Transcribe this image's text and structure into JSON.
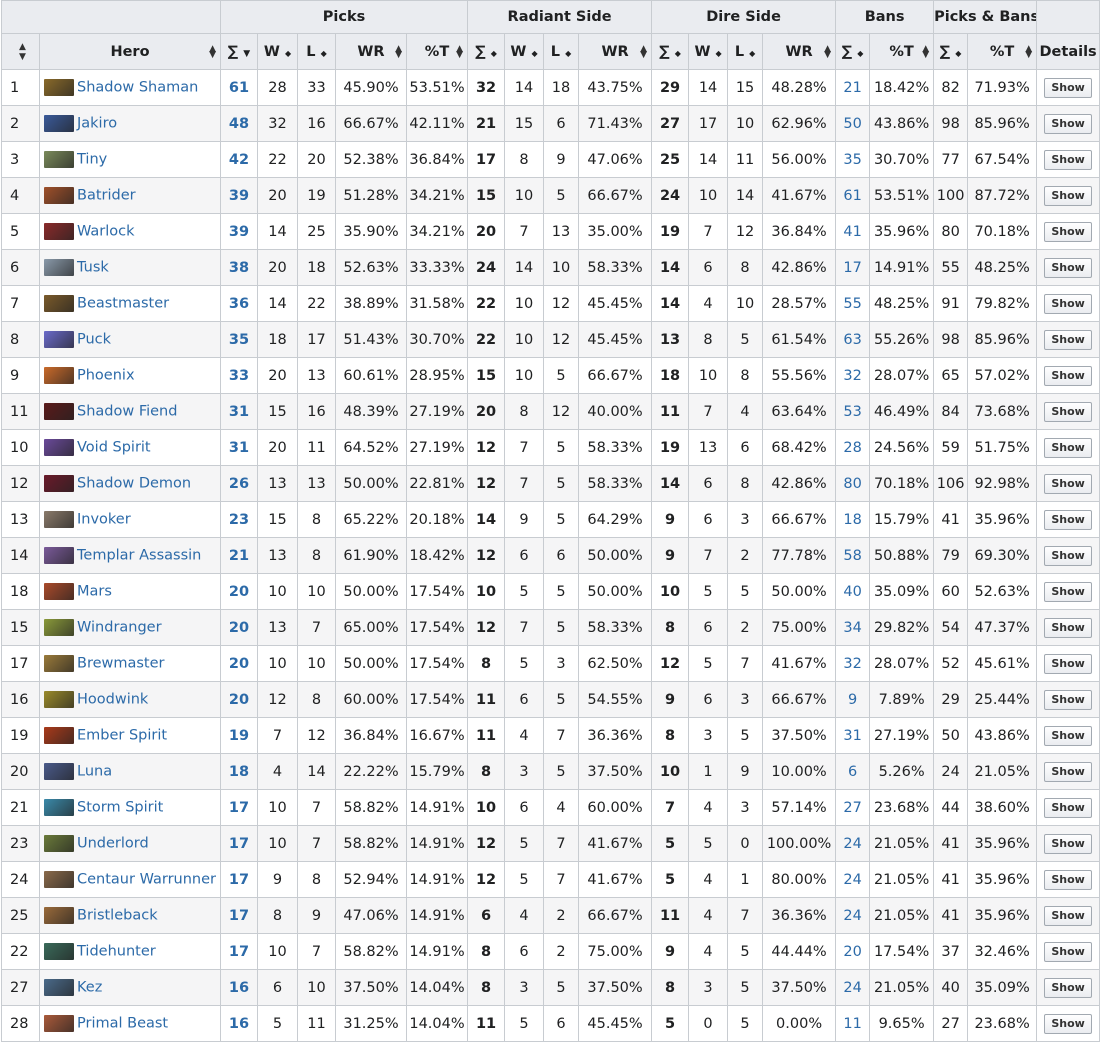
{
  "groups": [
    "Picks",
    "Radiant Side",
    "Dire Side",
    "Bans",
    "Picks & Bans"
  ],
  "columns": [
    "Hero",
    "∑",
    "W",
    "L",
    "WR",
    "%T",
    "∑",
    "W",
    "L",
    "WR",
    "∑",
    "W",
    "L",
    "WR",
    "∑",
    "%T",
    "∑",
    "%T",
    "Details"
  ],
  "button_label": "Show",
  "rows": [
    {
      "rank": "1",
      "hero": "Shadow Shaman",
      "ic": "#8a6a2a",
      "pt": "61",
      "pw": "28",
      "pl": "33",
      "pwr": "45.90%",
      "ppt": "53.51%",
      "rt": "32",
      "rw": "14",
      "rl": "18",
      "rwr": "43.75%",
      "dt": "29",
      "dw": "14",
      "dl": "15",
      "dwr": "48.28%",
      "bt": "21",
      "bpt": "18.42%",
      "pbt": "82",
      "pbpt": "71.93%"
    },
    {
      "rank": "2",
      "hero": "Jakiro",
      "ic": "#3a5a9a",
      "pt": "48",
      "pw": "32",
      "pl": "16",
      "pwr": "66.67%",
      "ppt": "42.11%",
      "rt": "21",
      "rw": "15",
      "rl": "6",
      "rwr": "71.43%",
      "dt": "27",
      "dw": "17",
      "dl": "10",
      "dwr": "62.96%",
      "bt": "50",
      "bpt": "43.86%",
      "pbt": "98",
      "pbpt": "85.96%"
    },
    {
      "rank": "3",
      "hero": "Tiny",
      "ic": "#7a8a5a",
      "pt": "42",
      "pw": "22",
      "pl": "20",
      "pwr": "52.38%",
      "ppt": "36.84%",
      "rt": "17",
      "rw": "8",
      "rl": "9",
      "rwr": "47.06%",
      "dt": "25",
      "dw": "14",
      "dl": "11",
      "dwr": "56.00%",
      "bt": "35",
      "bpt": "30.70%",
      "pbt": "77",
      "pbpt": "67.54%"
    },
    {
      "rank": "4",
      "hero": "Batrider",
      "ic": "#a0502a",
      "pt": "39",
      "pw": "20",
      "pl": "19",
      "pwr": "51.28%",
      "ppt": "34.21%",
      "rt": "15",
      "rw": "10",
      "rl": "5",
      "rwr": "66.67%",
      "dt": "24",
      "dw": "10",
      "dl": "14",
      "dwr": "41.67%",
      "bt": "61",
      "bpt": "53.51%",
      "pbt": "100",
      "pbpt": "87.72%"
    },
    {
      "rank": "5",
      "hero": "Warlock",
      "ic": "#8a2a2a",
      "pt": "39",
      "pw": "14",
      "pl": "25",
      "pwr": "35.90%",
      "ppt": "34.21%",
      "rt": "20",
      "rw": "7",
      "rl": "13",
      "rwr": "35.00%",
      "dt": "19",
      "dw": "7",
      "dl": "12",
      "dwr": "36.84%",
      "bt": "41",
      "bpt": "35.96%",
      "pbt": "80",
      "pbpt": "70.18%"
    },
    {
      "rank": "6",
      "hero": "Tusk",
      "ic": "#8a9aaa",
      "pt": "38",
      "pw": "20",
      "pl": "18",
      "pwr": "52.63%",
      "ppt": "33.33%",
      "rt": "24",
      "rw": "14",
      "rl": "10",
      "rwr": "58.33%",
      "dt": "14",
      "dw": "6",
      "dl": "8",
      "dwr": "42.86%",
      "bt": "17",
      "bpt": "14.91%",
      "pbt": "55",
      "pbpt": "48.25%"
    },
    {
      "rank": "7",
      "hero": "Beastmaster",
      "ic": "#7a5a2a",
      "pt": "36",
      "pw": "14",
      "pl": "22",
      "pwr": "38.89%",
      "ppt": "31.58%",
      "rt": "22",
      "rw": "10",
      "rl": "12",
      "rwr": "45.45%",
      "dt": "14",
      "dw": "4",
      "dl": "10",
      "dwr": "28.57%",
      "bt": "55",
      "bpt": "48.25%",
      "pbt": "91",
      "pbpt": "79.82%"
    },
    {
      "rank": "8",
      "hero": "Puck",
      "ic": "#6a6aca",
      "pt": "35",
      "pw": "18",
      "pl": "17",
      "pwr": "51.43%",
      "ppt": "30.70%",
      "rt": "22",
      "rw": "10",
      "rl": "12",
      "rwr": "45.45%",
      "dt": "13",
      "dw": "8",
      "dl": "5",
      "dwr": "61.54%",
      "bt": "63",
      "bpt": "55.26%",
      "pbt": "98",
      "pbpt": "85.96%"
    },
    {
      "rank": "9",
      "hero": "Phoenix",
      "ic": "#ca6a2a",
      "pt": "33",
      "pw": "20",
      "pl": "13",
      "pwr": "60.61%",
      "ppt": "28.95%",
      "rt": "15",
      "rw": "10",
      "rl": "5",
      "rwr": "66.67%",
      "dt": "18",
      "dw": "10",
      "dl": "8",
      "dwr": "55.56%",
      "bt": "32",
      "bpt": "28.07%",
      "pbt": "65",
      "pbpt": "57.02%"
    },
    {
      "rank": "11",
      "hero": "Shadow Fiend",
      "ic": "#5a1a1a",
      "pt": "31",
      "pw": "15",
      "pl": "16",
      "pwr": "48.39%",
      "ppt": "27.19%",
      "rt": "20",
      "rw": "8",
      "rl": "12",
      "rwr": "40.00%",
      "dt": "11",
      "dw": "7",
      "dl": "4",
      "dwr": "63.64%",
      "bt": "53",
      "bpt": "46.49%",
      "pbt": "84",
      "pbpt": "73.68%"
    },
    {
      "rank": "10",
      "hero": "Void Spirit",
      "ic": "#6a4a9a",
      "pt": "31",
      "pw": "20",
      "pl": "11",
      "pwr": "64.52%",
      "ppt": "27.19%",
      "rt": "12",
      "rw": "7",
      "rl": "5",
      "rwr": "58.33%",
      "dt": "19",
      "dw": "13",
      "dl": "6",
      "dwr": "68.42%",
      "bt": "28",
      "bpt": "24.56%",
      "pbt": "59",
      "pbpt": "51.75%"
    },
    {
      "rank": "12",
      "hero": "Shadow Demon",
      "ic": "#6a1a2a",
      "pt": "26",
      "pw": "13",
      "pl": "13",
      "pwr": "50.00%",
      "ppt": "22.81%",
      "rt": "12",
      "rw": "7",
      "rl": "5",
      "rwr": "58.33%",
      "dt": "14",
      "dw": "6",
      "dl": "8",
      "dwr": "42.86%",
      "bt": "80",
      "bpt": "70.18%",
      "pbt": "106",
      "pbpt": "92.98%"
    },
    {
      "rank": "13",
      "hero": "Invoker",
      "ic": "#8a7a6a",
      "pt": "23",
      "pw": "15",
      "pl": "8",
      "pwr": "65.22%",
      "ppt": "20.18%",
      "rt": "14",
      "rw": "9",
      "rl": "5",
      "rwr": "64.29%",
      "dt": "9",
      "dw": "6",
      "dl": "3",
      "dwr": "66.67%",
      "bt": "18",
      "bpt": "15.79%",
      "pbt": "41",
      "pbpt": "35.96%"
    },
    {
      "rank": "14",
      "hero": "Templar Assassin",
      "ic": "#7a5a9a",
      "pt": "21",
      "pw": "13",
      "pl": "8",
      "pwr": "61.90%",
      "ppt": "18.42%",
      "rt": "12",
      "rw": "6",
      "rl": "6",
      "rwr": "50.00%",
      "dt": "9",
      "dw": "7",
      "dl": "2",
      "dwr": "77.78%",
      "bt": "58",
      "bpt": "50.88%",
      "pbt": "79",
      "pbpt": "69.30%"
    },
    {
      "rank": "18",
      "hero": "Mars",
      "ic": "#aa4a2a",
      "pt": "20",
      "pw": "10",
      "pl": "10",
      "pwr": "50.00%",
      "ppt": "17.54%",
      "rt": "10",
      "rw": "5",
      "rl": "5",
      "rwr": "50.00%",
      "dt": "10",
      "dw": "5",
      "dl": "5",
      "dwr": "50.00%",
      "bt": "40",
      "bpt": "35.09%",
      "pbt": "60",
      "pbpt": "52.63%"
    },
    {
      "rank": "15",
      "hero": "Windranger",
      "ic": "#8a9a3a",
      "pt": "20",
      "pw": "13",
      "pl": "7",
      "pwr": "65.00%",
      "ppt": "17.54%",
      "rt": "12",
      "rw": "7",
      "rl": "5",
      "rwr": "58.33%",
      "dt": "8",
      "dw": "6",
      "dl": "2",
      "dwr": "75.00%",
      "bt": "34",
      "bpt": "29.82%",
      "pbt": "54",
      "pbpt": "47.37%"
    },
    {
      "rank": "17",
      "hero": "Brewmaster",
      "ic": "#9a7a3a",
      "pt": "20",
      "pw": "10",
      "pl": "10",
      "pwr": "50.00%",
      "ppt": "17.54%",
      "rt": "8",
      "rw": "5",
      "rl": "3",
      "rwr": "62.50%",
      "dt": "12",
      "dw": "5",
      "dl": "7",
      "dwr": "41.67%",
      "bt": "32",
      "bpt": "28.07%",
      "pbt": "52",
      "pbpt": "45.61%"
    },
    {
      "rank": "16",
      "hero": "Hoodwink",
      "ic": "#9a8a2a",
      "pt": "20",
      "pw": "12",
      "pl": "8",
      "pwr": "60.00%",
      "ppt": "17.54%",
      "rt": "11",
      "rw": "6",
      "rl": "5",
      "rwr": "54.55%",
      "dt": "9",
      "dw": "6",
      "dl": "3",
      "dwr": "66.67%",
      "bt": "9",
      "bpt": "7.89%",
      "pbt": "29",
      "pbpt": "25.44%"
    },
    {
      "rank": "19",
      "hero": "Ember Spirit",
      "ic": "#aa3a1a",
      "pt": "19",
      "pw": "7",
      "pl": "12",
      "pwr": "36.84%",
      "ppt": "16.67%",
      "rt": "11",
      "rw": "4",
      "rl": "7",
      "rwr": "36.36%",
      "dt": "8",
      "dw": "3",
      "dl": "5",
      "dwr": "37.50%",
      "bt": "31",
      "bpt": "27.19%",
      "pbt": "50",
      "pbpt": "43.86%"
    },
    {
      "rank": "20",
      "hero": "Luna",
      "ic": "#4a5a8a",
      "pt": "18",
      "pw": "4",
      "pl": "14",
      "pwr": "22.22%",
      "ppt": "15.79%",
      "rt": "8",
      "rw": "3",
      "rl": "5",
      "rwr": "37.50%",
      "dt": "10",
      "dw": "1",
      "dl": "9",
      "dwr": "10.00%",
      "bt": "6",
      "bpt": "5.26%",
      "pbt": "24",
      "pbpt": "21.05%"
    },
    {
      "rank": "21",
      "hero": "Storm Spirit",
      "ic": "#3a8aaa",
      "pt": "17",
      "pw": "10",
      "pl": "7",
      "pwr": "58.82%",
      "ppt": "14.91%",
      "rt": "10",
      "rw": "6",
      "rl": "4",
      "rwr": "60.00%",
      "dt": "7",
      "dw": "4",
      "dl": "3",
      "dwr": "57.14%",
      "bt": "27",
      "bpt": "23.68%",
      "pbt": "44",
      "pbpt": "38.60%"
    },
    {
      "rank": "23",
      "hero": "Underlord",
      "ic": "#6a7a3a",
      "pt": "17",
      "pw": "10",
      "pl": "7",
      "pwr": "58.82%",
      "ppt": "14.91%",
      "rt": "12",
      "rw": "5",
      "rl": "7",
      "rwr": "41.67%",
      "dt": "5",
      "dw": "5",
      "dl": "0",
      "dwr": "100.00%",
      "bt": "24",
      "bpt": "21.05%",
      "pbt": "41",
      "pbpt": "35.96%"
    },
    {
      "rank": "24",
      "hero": "Centaur Warrunner",
      "ic": "#8a6a4a",
      "pt": "17",
      "pw": "9",
      "pl": "8",
      "pwr": "52.94%",
      "ppt": "14.91%",
      "rt": "12",
      "rw": "5",
      "rl": "7",
      "rwr": "41.67%",
      "dt": "5",
      "dw": "4",
      "dl": "1",
      "dwr": "80.00%",
      "bt": "24",
      "bpt": "21.05%",
      "pbt": "41",
      "pbpt": "35.96%"
    },
    {
      "rank": "25",
      "hero": "Bristleback",
      "ic": "#9a6a3a",
      "pt": "17",
      "pw": "8",
      "pl": "9",
      "pwr": "47.06%",
      "ppt": "14.91%",
      "rt": "6",
      "rw": "4",
      "rl": "2",
      "rwr": "66.67%",
      "dt": "11",
      "dw": "4",
      "dl": "7",
      "dwr": "36.36%",
      "bt": "24",
      "bpt": "21.05%",
      "pbt": "41",
      "pbpt": "35.96%"
    },
    {
      "rank": "22",
      "hero": "Tidehunter",
      "ic": "#3a6a5a",
      "pt": "17",
      "pw": "10",
      "pl": "7",
      "pwr": "58.82%",
      "ppt": "14.91%",
      "rt": "8",
      "rw": "6",
      "rl": "2",
      "rwr": "75.00%",
      "dt": "9",
      "dw": "4",
      "dl": "5",
      "dwr": "44.44%",
      "bt": "20",
      "bpt": "17.54%",
      "pbt": "37",
      "pbpt": "32.46%"
    },
    {
      "rank": "27",
      "hero": "Kez",
      "ic": "#4a6a8a",
      "pt": "16",
      "pw": "6",
      "pl": "10",
      "pwr": "37.50%",
      "ppt": "14.04%",
      "rt": "8",
      "rw": "3",
      "rl": "5",
      "rwr": "37.50%",
      "dt": "8",
      "dw": "3",
      "dl": "5",
      "dwr": "37.50%",
      "bt": "24",
      "bpt": "21.05%",
      "pbt": "40",
      "pbpt": "35.09%"
    },
    {
      "rank": "28",
      "hero": "Primal Beast",
      "ic": "#aa5a3a",
      "pt": "16",
      "pw": "5",
      "pl": "11",
      "pwr": "31.25%",
      "ppt": "14.04%",
      "rt": "11",
      "rw": "5",
      "rl": "6",
      "rwr": "45.45%",
      "dt": "5",
      "dw": "0",
      "dl": "5",
      "dwr": "0.00%",
      "bt": "11",
      "bpt": "9.65%",
      "pbt": "27",
      "pbpt": "23.68%"
    }
  ]
}
